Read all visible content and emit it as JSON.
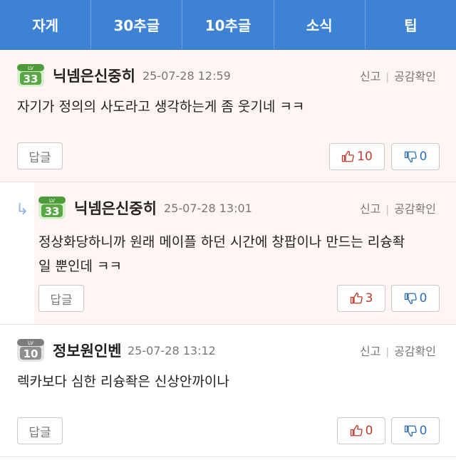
{
  "tabs": [
    {
      "label": "자게"
    },
    {
      "label": "30추글"
    },
    {
      "label": "10추글"
    },
    {
      "label": "소식"
    },
    {
      "label": "팁"
    }
  ],
  "comments": [
    {
      "level": "33",
      "badge_color": "#5aa845",
      "nickname": "닉넴은신중히",
      "time": "25-07-28 12:59",
      "report": "신고",
      "sep": "|",
      "likes_check": "공감확인",
      "text": "자기가 정의의 사도라고 생각하는게 좀 웃기네 ㅋㅋ",
      "reply_label": "답글",
      "like_count": "10",
      "dislike_count": "0"
    },
    {
      "level": "33",
      "badge_color": "#5aa845",
      "nickname": "닉넴은신중히",
      "time": "25-07-28 13:01",
      "report": "신고",
      "sep": "|",
      "likes_check": "공감확인",
      "text_line1": "정상화당하니까 원래 메이플 하던 시간에 창팝이나 만드는 리슝좍",
      "text_line2": "일 뿐인데 ㅋㅋ",
      "reply_arrow": "↳",
      "reply_label": "답글",
      "like_count": "3",
      "dislike_count": "0"
    },
    {
      "level": "10",
      "badge_color": "#8e8e8e",
      "nickname": "정보원인벤",
      "time": "25-07-28 13:12",
      "report": "신고",
      "sep": "|",
      "likes_check": "공감확인",
      "text": "렉카보다 심한 리슝좍은 신상안까이나",
      "reply_label": "답글",
      "like_count": "0",
      "dislike_count": "0"
    }
  ]
}
